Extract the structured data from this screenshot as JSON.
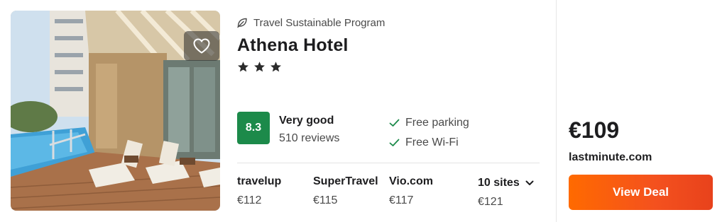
{
  "colors": {
    "score_badge": "#1c8a4a",
    "deal_button": "#f4511e",
    "check": "#1c8a4a"
  },
  "photo": {
    "favorite_icon": "heart-icon"
  },
  "eco_program": {
    "icon": "leaf-icon",
    "label": "Travel Sustainable Program"
  },
  "hotel": {
    "name": "Athena Hotel",
    "star_count": 3,
    "star_icon": "star-icon"
  },
  "rating": {
    "score": "8.3",
    "label": "Very good",
    "reviews": "510 reviews"
  },
  "amenities": [
    {
      "icon": "check-icon",
      "label": "Free parking"
    },
    {
      "icon": "check-icon",
      "label": "Free Wi-Fi"
    }
  ],
  "providers": [
    {
      "name": "travelup",
      "price": "€112"
    },
    {
      "name": "SuperTravel",
      "price": "€115"
    },
    {
      "name": "Vio.com",
      "price": "€117"
    }
  ],
  "more_sites": {
    "label": "10 sites",
    "price": "€121",
    "icon": "chevron-down-icon"
  },
  "deal": {
    "price": "€109",
    "source": "lastminute.com",
    "button_label": "View Deal"
  }
}
